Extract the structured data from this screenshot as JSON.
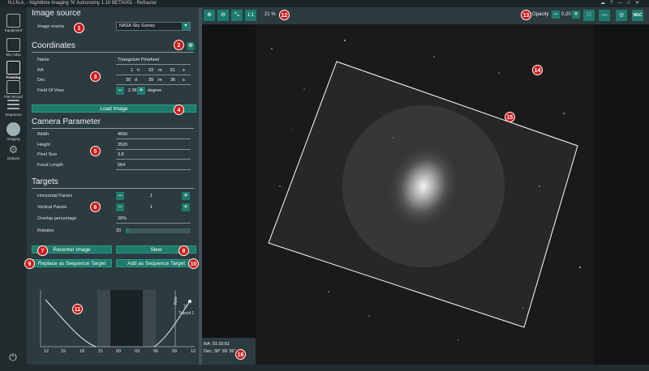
{
  "window": {
    "title": "N.I.N.A. - Nighttime Imaging 'N' Astronomy 1.10 BETA001 - Refractor"
  },
  "nav": {
    "items": [
      {
        "label": "Equipment"
      },
      {
        "label": "Sky Atlas"
      },
      {
        "label": "Framing"
      },
      {
        "label": "Flat Wizard"
      },
      {
        "label": "Sequence"
      },
      {
        "label": "Imaging"
      },
      {
        "label": "Options"
      }
    ]
  },
  "image_source": {
    "heading": "Image source",
    "label": "Image source",
    "selected": "NASA Sky Survey"
  },
  "coordinates": {
    "heading": "Coordinates",
    "name_label": "Name",
    "name_value": "Triangulum Pinwheel",
    "ra_label": "RA",
    "ra_h": "1",
    "ra_h_unit": "h",
    "ra_m": "33",
    "ra_m_unit": "m",
    "ra_s": "51",
    "ra_s_unit": "s",
    "dec_label": "Dec",
    "dec_d": "30",
    "dec_d_unit": "d",
    "dec_m": "39",
    "dec_m_unit": "m",
    "dec_s": "36",
    "dec_s_unit": "s",
    "fov_label": "Field Of View",
    "fov_value": "2.36",
    "fov_unit": "degree",
    "load_button": "Load Image"
  },
  "camera": {
    "heading": "Camera Parameter",
    "width_label": "Width",
    "width_value": "4656",
    "height_label": "Height",
    "height_value": "3520",
    "pixel_label": "Pixel Size",
    "pixel_value": "3.8",
    "focal_label": "Focal Length",
    "focal_value": "564"
  },
  "targets": {
    "heading": "Targets",
    "hpanels_label": "Horizontal Panels",
    "hpanels_value": "1",
    "vpanels_label": "Vertical Panels",
    "vpanels_value": "1",
    "overlap_label": "Overlap percentage",
    "overlap_value": "20%",
    "rotation_label": "Rotation",
    "rotation_value": "20",
    "rotation_level": 0.05
  },
  "actions": {
    "recenter": "Recenter Image",
    "slew": "Slew",
    "replace": "Replace as Sequence Target",
    "add": "Add as Sequence Target"
  },
  "altitude_chart": {
    "x_ticks": [
      "12",
      "15",
      "18",
      "21",
      "00",
      "03",
      "06",
      "09",
      "12"
    ],
    "now_label": "Now",
    "transit_label": "Transit 1",
    "alt_label": "77"
  },
  "toolbar": {
    "zoom_in_icon": "zoom-in-icon",
    "zoom_out_icon": "zoom-out-icon",
    "fit_icon": "fit-icon",
    "one_to_one": "1:1",
    "zoom_level": "21 %",
    "opacity_label": "Opacity",
    "opacity_value": "0.20",
    "ngc_label": "NGC"
  },
  "status": {
    "ra": "RA: 01:33:51",
    "dec": "Dec: 30° 39' 36\""
  },
  "badges": [
    "1",
    "2",
    "3",
    "4",
    "5",
    "6",
    "7",
    "8",
    "9",
    "10",
    "11",
    "12",
    "13",
    "14",
    "15",
    "16"
  ],
  "colors": {
    "accent": "#1e7b6c",
    "panel": "#2c3b40",
    "badge": "#d01a1a"
  }
}
